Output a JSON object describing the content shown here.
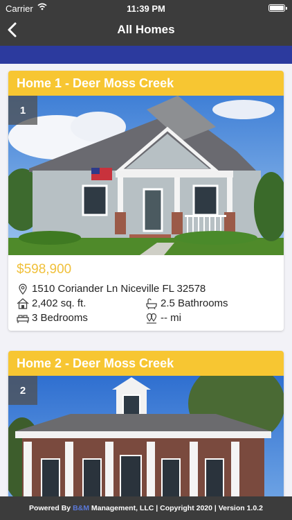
{
  "status_bar": {
    "carrier": "Carrier",
    "time": "11:39 PM"
  },
  "nav": {
    "title": "All Homes",
    "back_icon": "chevron-left-icon"
  },
  "homes": [
    {
      "number": "1",
      "title": "Home 1 - Deer Moss Creek",
      "price": "$598,900",
      "address": "1510 Coriander Ln Niceville FL 32578",
      "sqft": "2,402 sq. ft.",
      "bathrooms": "2.5 Bathrooms",
      "bedrooms": "3 Bedrooms",
      "distance": "-- mi"
    },
    {
      "number": "2",
      "title": "Home 2 - Deer Moss Creek"
    }
  ],
  "footer": {
    "prefix": "Powered By ",
    "brand": "B&M",
    "suffix": " Management, LLC | Copyright 2020 | Version 1.0.2"
  },
  "colors": {
    "nav_bg": "#3c3c3c",
    "accent_blue": "#2c3a9e",
    "title_yellow": "#f7c632",
    "price_gold": "#f0c03a"
  }
}
